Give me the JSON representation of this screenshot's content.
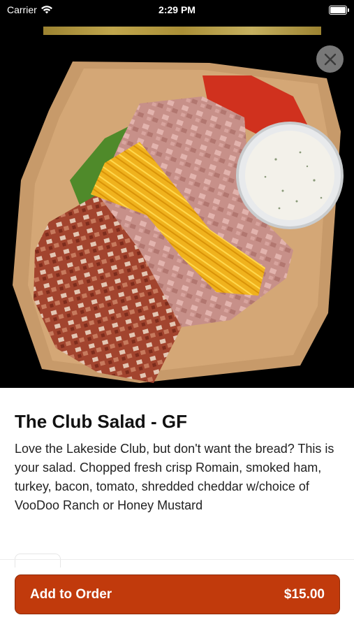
{
  "status_bar": {
    "carrier": "Carrier",
    "time": "2:29 PM"
  },
  "item": {
    "title": "The Club Salad - GF",
    "description": "Love the Lakeside Club, but don't want the bread? This is your salad. Chopped fresh crisp Romain, smoked ham, turkey, bacon, tomato, shredded cheddar w/choice of VooDoo Ranch or Honey Mustard",
    "image_icon": "salad-photo"
  },
  "actions": {
    "add_label": "Add to Order",
    "price": "$15.00",
    "close_icon": "close-icon"
  },
  "colors": {
    "accent": "#c13a0c",
    "background": "#000000"
  }
}
